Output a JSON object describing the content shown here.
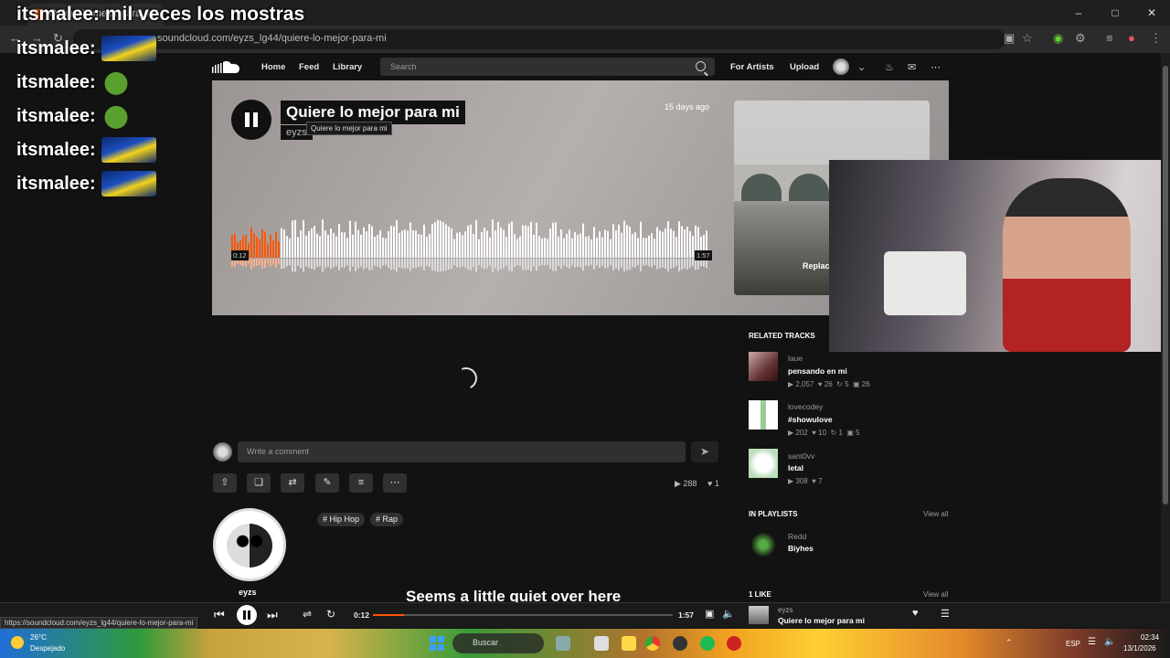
{
  "browser": {
    "tab_title": "Quiere lo mejor para mi",
    "url": "soundcloud.com/eyzs_lg44/quiere-lo-mejor-para-mi",
    "status_url": "https://soundcloud.com/eyzs_lg44/quiere-lo-mejor-para-mi"
  },
  "chat": {
    "title": "itsmalee: mil veces los mostras",
    "lines": [
      {
        "user": "itsmalee:",
        "emote": "car-emote"
      },
      {
        "user": "itsmalee:",
        "emote": "pepe-emote"
      },
      {
        "user": "itsmalee:",
        "emote": "pepe-emote"
      },
      {
        "user": "itsmalee:",
        "emote": "car-emote"
      },
      {
        "user": "itsmalee:",
        "emote": "car-emote"
      }
    ]
  },
  "header": {
    "nav": [
      "Home",
      "Feed",
      "Library"
    ],
    "search_placeholder": "Search",
    "for_artists": "For Artists",
    "upload": "Upload"
  },
  "track": {
    "title": "Quiere lo mejor para mi",
    "artist": "eyzs",
    "tooltip": "Quiere lo mejor para mi",
    "posted": "15 days ago",
    "time_current": "0:12",
    "time_total": "1:57",
    "progress": 0.1026,
    "replace_label": "Replac",
    "plays": "288",
    "likes": "1",
    "tags": [
      "# Hip Hop",
      "# Rap"
    ]
  },
  "comment": {
    "placeholder": "Write a comment"
  },
  "artist_section": {
    "name": "eyzs",
    "quiet_message": "Seems a little quiet over here"
  },
  "sidebar": {
    "related_heading": "RELATED TRACKS",
    "related": [
      {
        "user": "laue",
        "title": "pensando en mi",
        "plays": "2,057",
        "likes": "26",
        "reposts": "5",
        "comments": "26"
      },
      {
        "user": "lovecodey",
        "title": "#showulove",
        "plays": "202",
        "likes": "10",
        "reposts": "1",
        "comments": "5"
      },
      {
        "user": "sant0vv",
        "title": "letal",
        "plays": "308",
        "likes": "7"
      }
    ],
    "playlists_heading": "IN PLAYLISTS",
    "playlists_viewall": "View all",
    "playlist": {
      "user": "Redd",
      "title": "Biyhes"
    },
    "likes_heading": "1 LIKE",
    "likes_viewall": "View all"
  },
  "player": {
    "time_current": "0:12",
    "time_total": "1:57",
    "user": "eyzs",
    "title": "Quiere lo mejor para mi"
  },
  "taskbar": {
    "temp": "26°C",
    "weather": "Despejado",
    "search": "Buscar",
    "lang": "ESP",
    "time": "02:34",
    "date": "13/1/2026"
  },
  "colors": {
    "accent": "#ff5500",
    "background": "#121212"
  }
}
